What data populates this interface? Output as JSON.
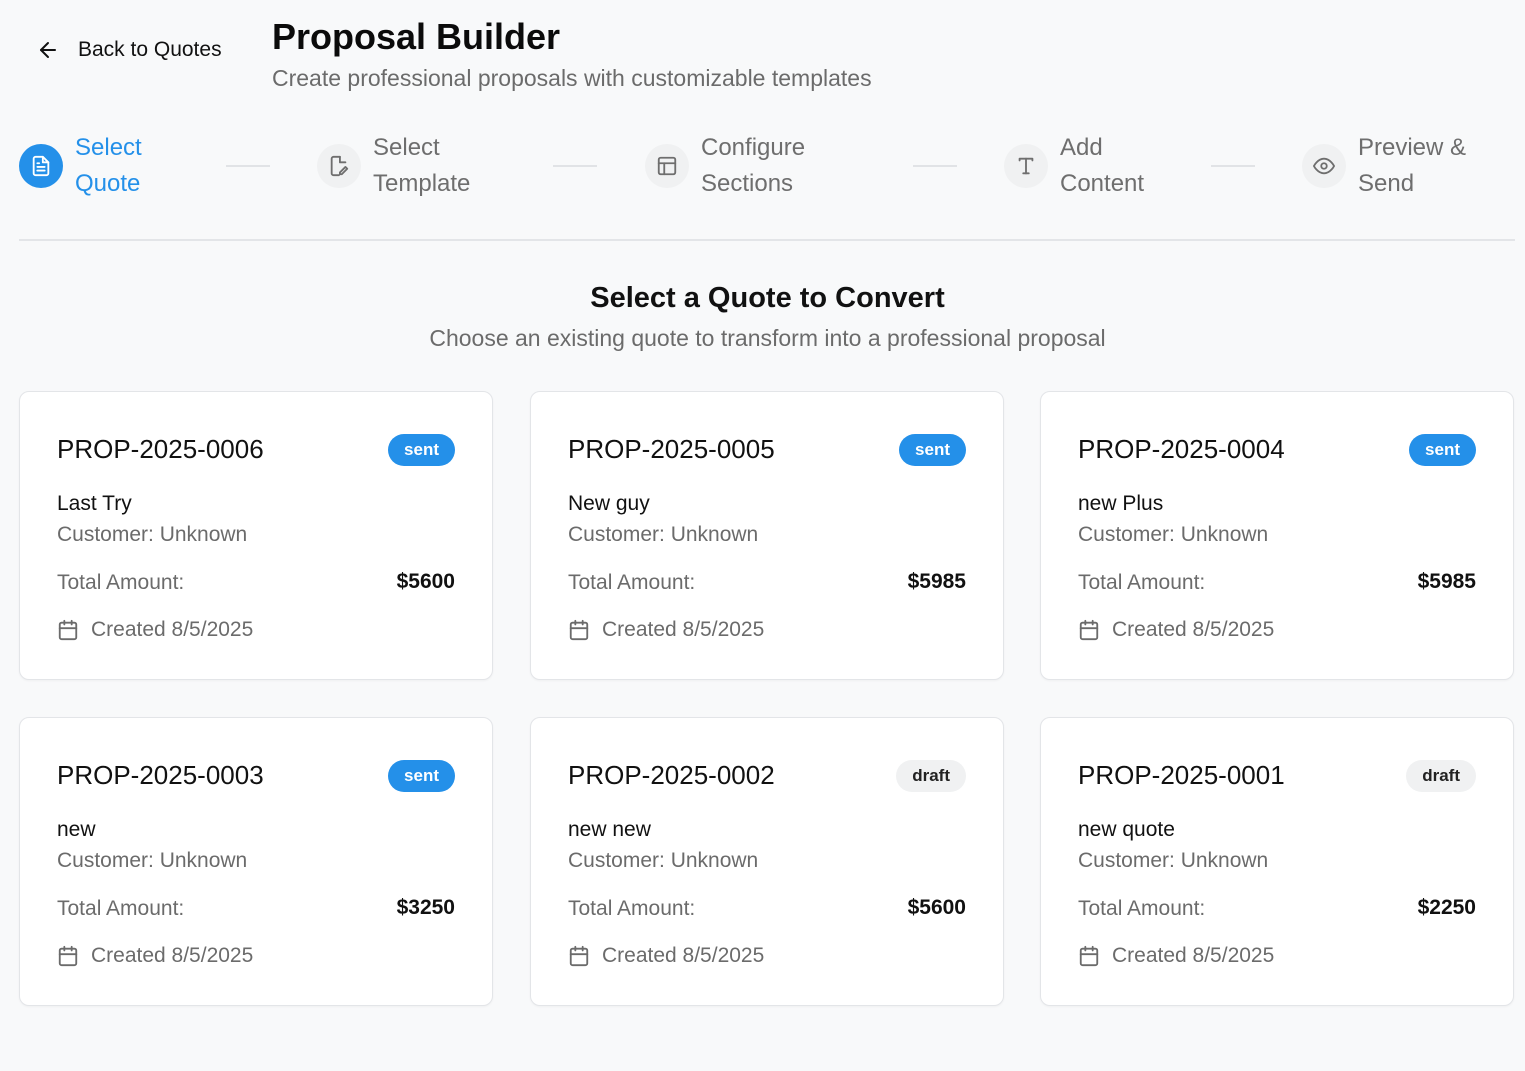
{
  "header": {
    "back_label": "Back to Quotes",
    "title": "Proposal Builder",
    "subtitle": "Create professional proposals with customizable templates"
  },
  "steps": [
    {
      "label": "Select Quote",
      "icon": "file-text-icon",
      "active": true
    },
    {
      "label": "Select Template",
      "icon": "edit-document-icon",
      "active": false
    },
    {
      "label": "Configure Sections",
      "icon": "layout-icon",
      "active": false
    },
    {
      "label": "Add Content",
      "icon": "type-icon",
      "active": false
    },
    {
      "label": "Preview & Send",
      "icon": "eye-icon",
      "active": false
    }
  ],
  "section": {
    "title": "Select a Quote to Convert",
    "subtitle": "Choose an existing quote to transform into a professional proposal"
  },
  "colors": {
    "accent": "#2490e9",
    "background": "#f8f9fa",
    "draft_badge": "#f0f1f2"
  },
  "quotes": [
    {
      "id": "PROP-2025-0006",
      "status": "sent",
      "name": "Last Try",
      "customer": "Customer: Unknown",
      "amount_label": "Total Amount:",
      "amount": "$5600",
      "created": "Created 8/5/2025"
    },
    {
      "id": "PROP-2025-0005",
      "status": "sent",
      "name": "New guy",
      "customer": "Customer: Unknown",
      "amount_label": "Total Amount:",
      "amount": "$5985",
      "created": "Created 8/5/2025"
    },
    {
      "id": "PROP-2025-0004",
      "status": "sent",
      "name": "new Plus",
      "customer": "Customer: Unknown",
      "amount_label": "Total Amount:",
      "amount": "$5985",
      "created": "Created 8/5/2025"
    },
    {
      "id": "PROP-2025-0003",
      "status": "sent",
      "name": "new",
      "customer": "Customer: Unknown",
      "amount_label": "Total Amount:",
      "amount": "$3250",
      "created": "Created 8/5/2025"
    },
    {
      "id": "PROP-2025-0002",
      "status": "draft",
      "name": "new new",
      "customer": "Customer: Unknown",
      "amount_label": "Total Amount:",
      "amount": "$5600",
      "created": "Created 8/5/2025"
    },
    {
      "id": "PROP-2025-0001",
      "status": "draft",
      "name": "new quote",
      "customer": "Customer: Unknown",
      "amount_label": "Total Amount:",
      "amount": "$2250",
      "created": "Created 8/5/2025"
    }
  ]
}
